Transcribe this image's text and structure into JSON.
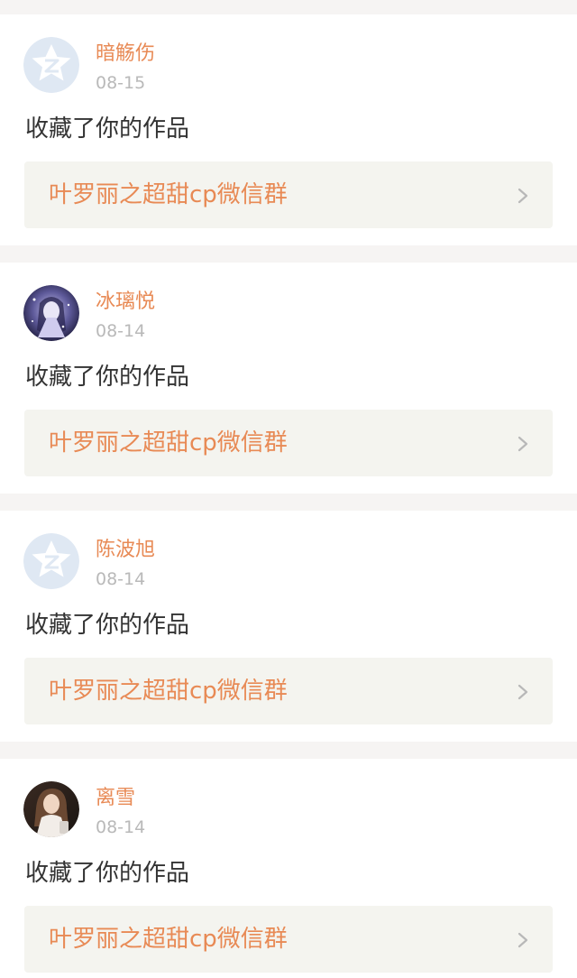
{
  "colors": {
    "page_bg": "#f6f4f3",
    "card_bg": "#ffffff",
    "username": "#e88a55",
    "date": "#b9b9b9",
    "action_text": "#333333",
    "link_bg": "#f4f4ef",
    "link_text": "#e88a55",
    "chevron": "#b8b8b8",
    "default_avatar": "#dfe8f3"
  },
  "notifications": [
    {
      "username": "暗觞伤",
      "date": "08-15",
      "action": "收藏了你的作品",
      "work_title": "叶罗丽之超甜cp微信群",
      "avatar_icon": "default-qq-avatar-icon",
      "chevron_icon": "chevron-right-icon"
    },
    {
      "username": "冰璃悦",
      "date": "08-14",
      "action": "收藏了你的作品",
      "work_title": "叶罗丽之超甜cp微信群",
      "avatar_icon": "anime-girl-avatar-icon",
      "chevron_icon": "chevron-right-icon"
    },
    {
      "username": "陈波旭",
      "date": "08-14",
      "action": "收藏了你的作品",
      "work_title": "叶罗丽之超甜cp微信群",
      "avatar_icon": "default-qq-avatar-icon",
      "chevron_icon": "chevron-right-icon"
    },
    {
      "username": "离雪",
      "date": "08-14",
      "action": "收藏了你的作品",
      "work_title": "叶罗丽之超甜cp微信群",
      "avatar_icon": "photo-girl-avatar-icon",
      "chevron_icon": "chevron-right-icon"
    }
  ]
}
